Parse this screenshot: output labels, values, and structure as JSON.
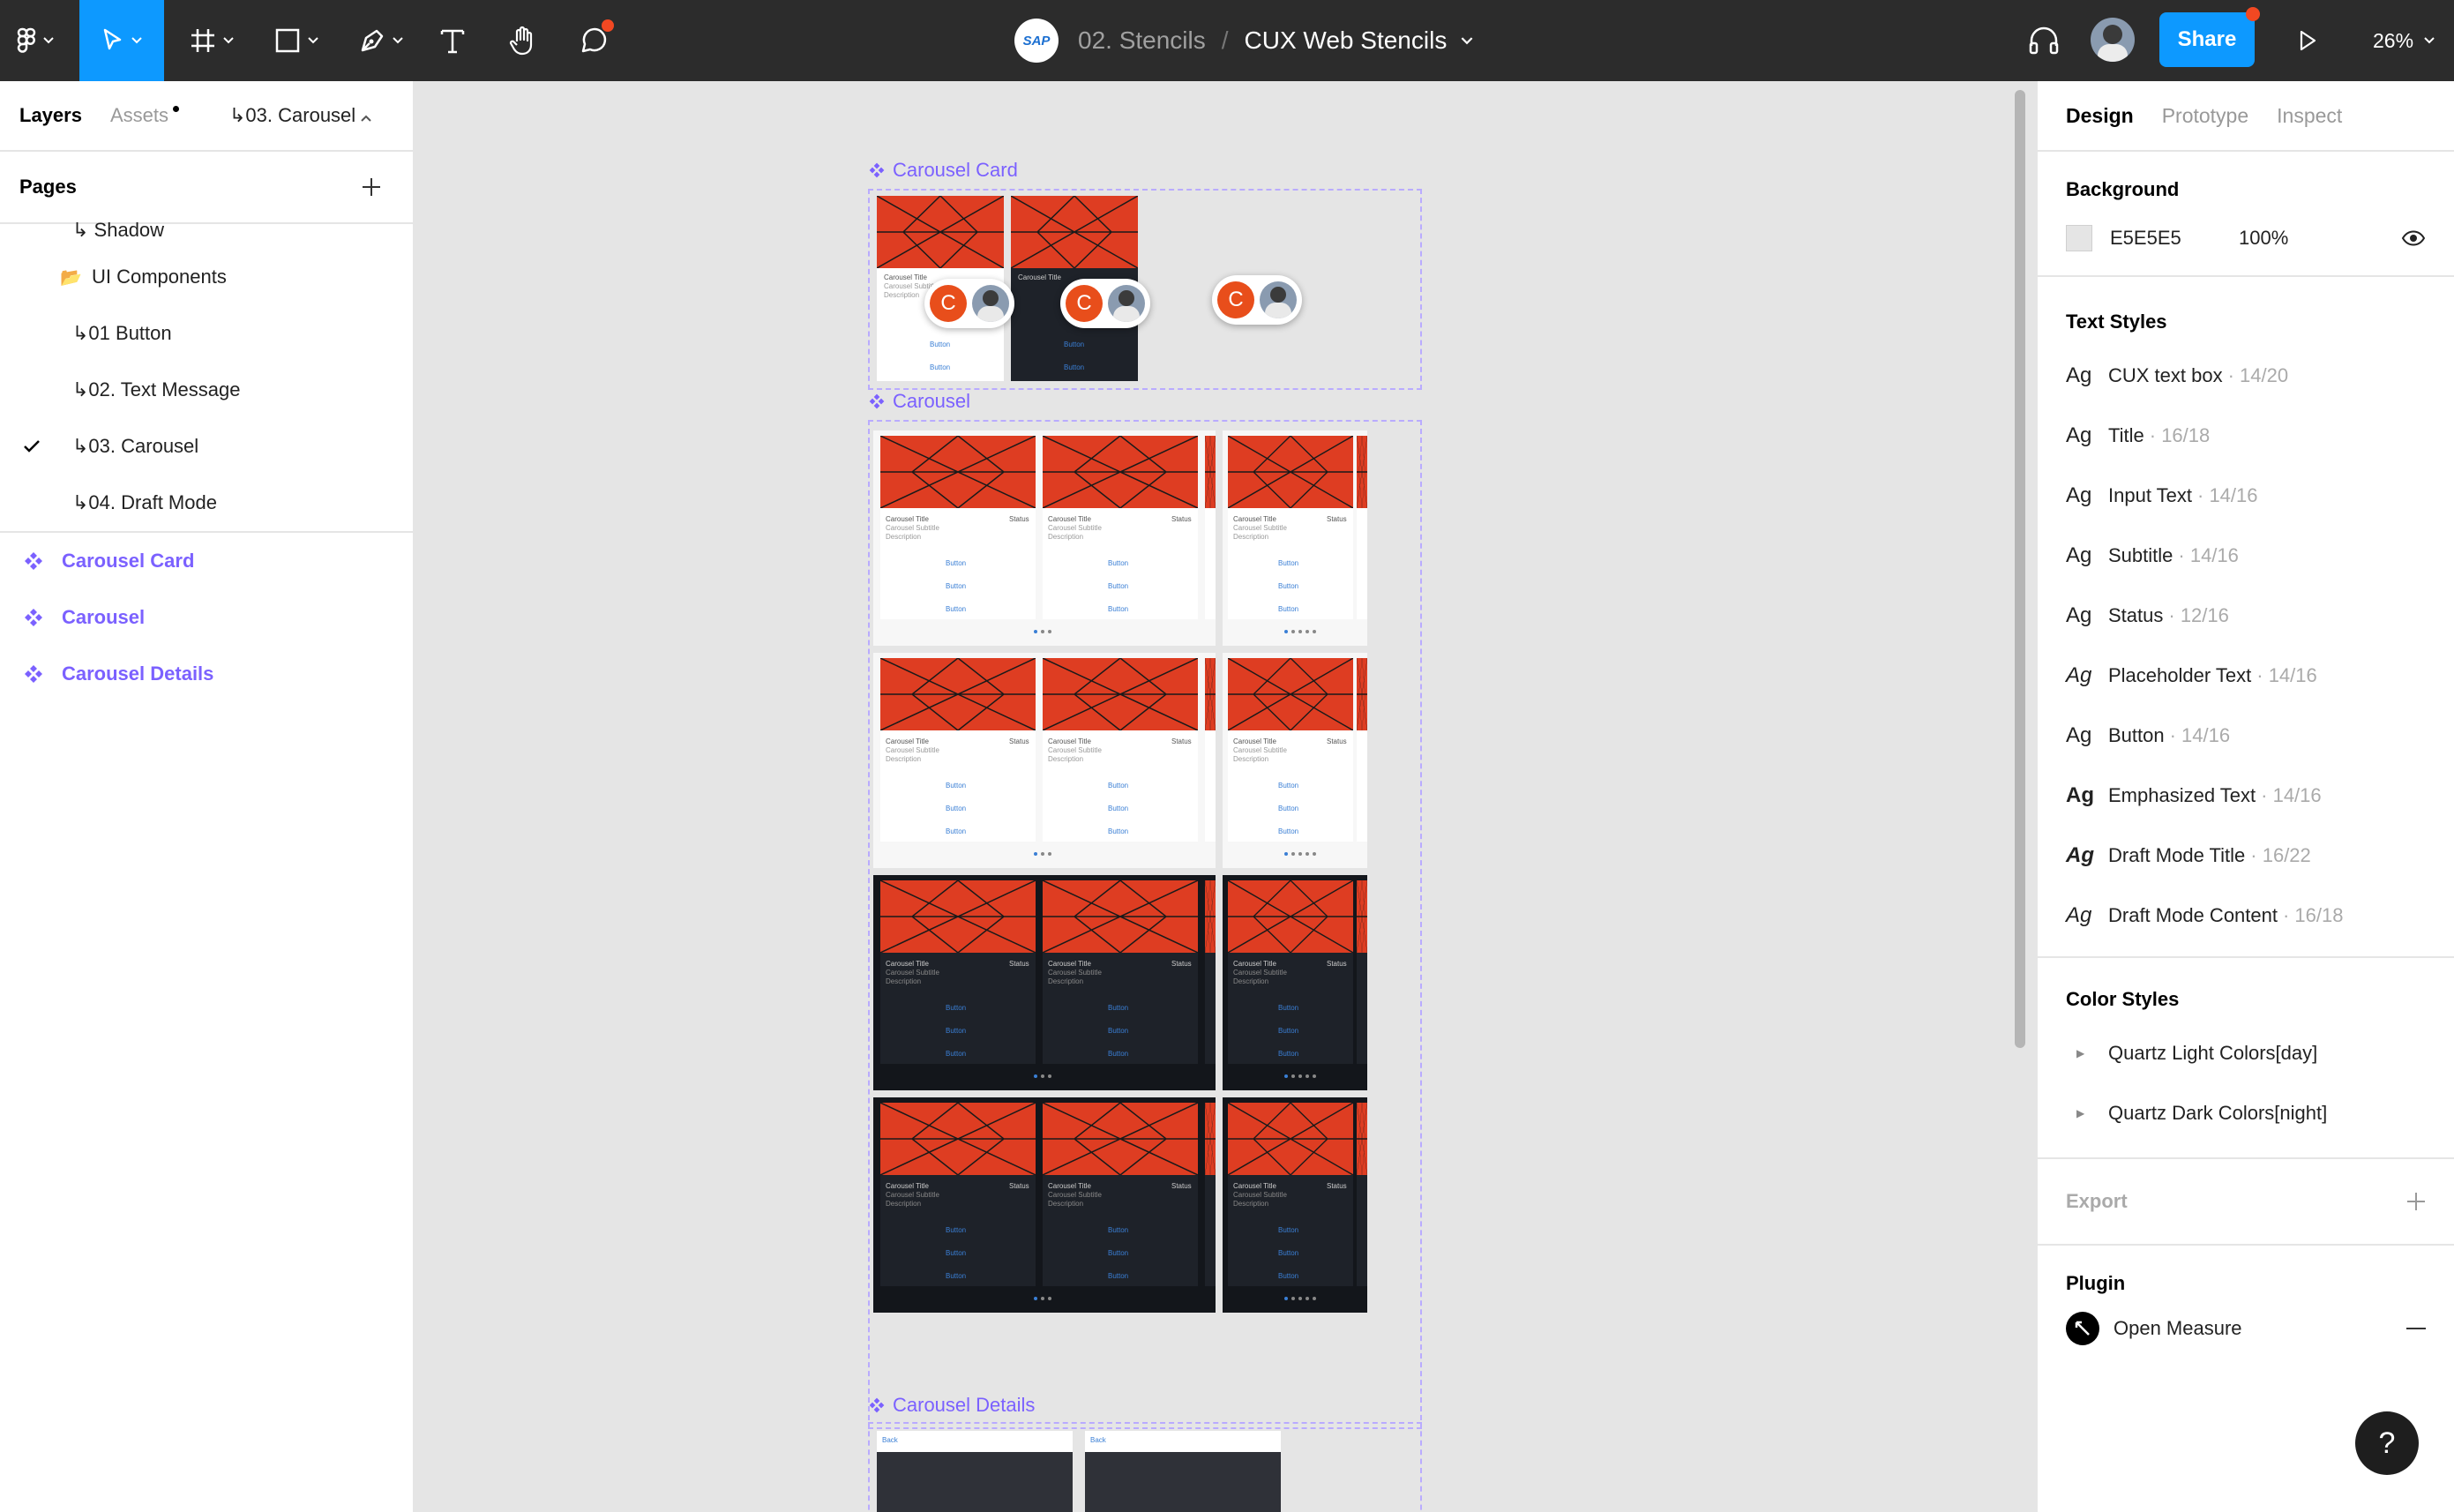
{
  "toolbar": {
    "project": "02. Stencils",
    "separator": "/",
    "file": "CUX Web Stencils",
    "sap_logo": "SAP",
    "share_label": "Share",
    "zoom": "26%",
    "icons": [
      "figma-menu-icon",
      "move-tool-icon",
      "frame-tool-icon",
      "shape-tool-icon",
      "pen-tool-icon",
      "text-tool-icon",
      "hand-tool-icon",
      "comment-tool-icon",
      "headphones-icon",
      "avatar",
      "play-icon",
      "chevron-down-icon"
    ]
  },
  "left_panel": {
    "tabs": {
      "layers": "Layers",
      "assets": "Assets",
      "current_page": "↳03. Carousel"
    },
    "pages_title": "Pages",
    "pages": [
      {
        "label": "↳ Shadow",
        "selected": false
      },
      {
        "label": "UI Components",
        "selected": false,
        "folder": true
      },
      {
        "label": "↳01 Button",
        "selected": false
      },
      {
        "label": "↳02. Text Message",
        "selected": false
      },
      {
        "label": "↳03. Carousel",
        "selected": true
      },
      {
        "label": "↳04. Draft Mode",
        "selected": false
      }
    ],
    "components": [
      "Carousel Card",
      "Carousel",
      "Carousel Details"
    ]
  },
  "canvas": {
    "frames": [
      "Carousel Card",
      "Carousel",
      "Carousel Details"
    ],
    "badge_letter": "C",
    "card_text": {
      "title": "Carousel Title",
      "subtitle": "Carousel Subtitle",
      "description": "Description",
      "status": "Status",
      "button": "Button",
      "back": "Back"
    }
  },
  "right_panel": {
    "tabs": {
      "design": "Design",
      "prototype": "Prototype",
      "inspect": "Inspect"
    },
    "background": {
      "title": "Background",
      "hex": "E5E5E5",
      "opacity": "100%"
    },
    "text_styles_title": "Text Styles",
    "text_styles": [
      {
        "name": "CUX text box",
        "meta": "· 14/20"
      },
      {
        "name": "Title",
        "meta": "· 16/18"
      },
      {
        "name": "Input Text",
        "meta": "· 14/16"
      },
      {
        "name": "Subtitle",
        "meta": "· 14/16"
      },
      {
        "name": "Status",
        "meta": "· 12/16"
      },
      {
        "name": "Placeholder Text",
        "meta": "· 14/16"
      },
      {
        "name": "Button",
        "meta": "· 14/16"
      },
      {
        "name": "Emphasized Text",
        "meta": "· 14/16"
      },
      {
        "name": "Draft Mode Title",
        "meta": "· 16/22"
      },
      {
        "name": "Draft Mode Content",
        "meta": "· 16/18"
      }
    ],
    "ag_label": "Ag",
    "color_styles_title": "Color Styles",
    "color_styles": [
      "Quartz Light Colors[day]",
      "Quartz Dark Colors[night]"
    ],
    "export_title": "Export",
    "plugin_title": "Plugin",
    "plugin_name": "Open Measure",
    "help": "?"
  },
  "colors": {
    "accent": "#0d99ff",
    "component": "#7b61ff",
    "card_image": "#de3d22",
    "dark_card": "#1e2229"
  }
}
